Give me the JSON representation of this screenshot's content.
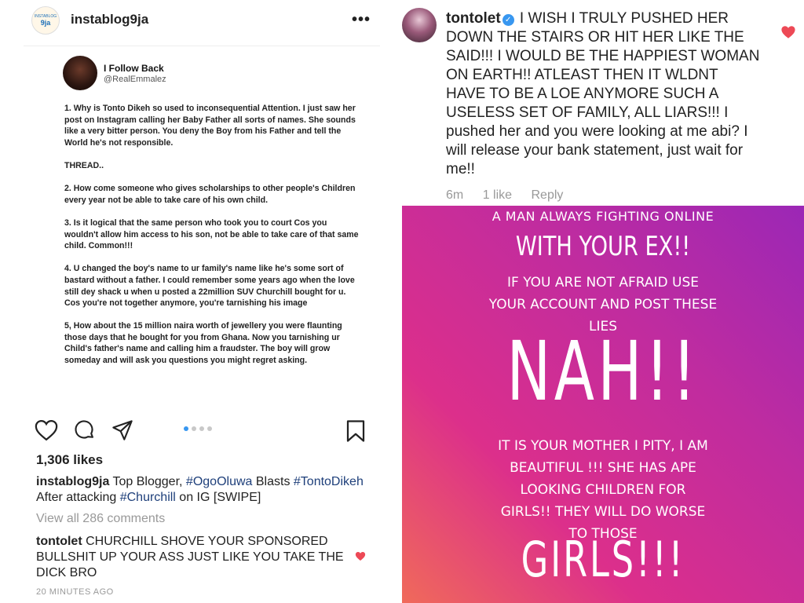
{
  "left_post": {
    "logo_text_top": "INSTABLOG",
    "logo_text_bottom": "9ja",
    "username": "instablog9ja",
    "more": "•••",
    "tweet": {
      "name": "I Follow Back",
      "handle": "@RealEmmalez",
      "paragraphs": [
        "1. Why is Tonto Dikeh so used to inconsequential Attention. I just saw her post on Instagram calling her Baby Father all sorts of names. She sounds like a very bitter person. You deny the Boy from his Father and tell the World he's not responsible.",
        "THREAD..",
        "2. How come someone who gives scholarships to other people's Children every year not be able to take care of his own child.",
        "3. Is it logical that the same person who took you to court Cos you wouldn't allow him access to his son, not be able to take care of that same child. Common!!!",
        "4. U changed the boy's name to ur family's name like he's some sort of bastard without a father. I could remember some years ago when the love still dey shack u when u posted a 22million SUV Churchill bought for u. Cos you're not together anymore, you're tarnishing his image",
        "5, How about the 15 million naira worth of jewellery you were flaunting those days that he bought for you from Ghana. Now you tarnishing ur Child's father's name and calling him a fraudster. The boy will grow someday and will ask you questions you might regret asking."
      ]
    },
    "likes": "1,306 likes",
    "caption": {
      "username": "instablog9ja",
      "text_1": " Top Blogger, ",
      "tag_1": "#OgoOluwa",
      "text_2": " Blasts ",
      "tag_2": "#TontoDikeh",
      "text_3": " After attacking ",
      "tag_3": "#Churchill",
      "text_4": " on IG [SWIPE]"
    },
    "view_all": "View all 286 comments",
    "comment": {
      "username": "tontolet",
      "text": " CHURCHILL SHOVE YOUR SPONSORED BULLSHIT UP YOUR ASS JUST LIKE YOU TAKE THE DICK BRO"
    },
    "time_ago": "20 MINUTES AGO"
  },
  "right_post": {
    "comment": {
      "username": "tontolet",
      "verified_mark": "✓",
      "text": " I WISH I TRULY PUSHED HER DOWN THE STAIRS OR HIT HER LIKE THE SAID!!! I WOULD BE THE HAPPIEST WOMAN ON EARTH!! ATLEAST THEN IT WLDNT HAVE TO BE A LOE ANYMORE SUCH A USELESS SET OF FAMILY, ALL LIARS!!! I pushed her and you were looking at me abi? I will release your bank statement, just wait for me!!"
    },
    "meta": {
      "time": "6m",
      "likes": "1 like",
      "reply": "Reply"
    },
    "story": {
      "line1": "A MAN ALWAYS FIGHTING ONLINE",
      "line2": "WITH YOUR EX!!",
      "line3": "IF YOU ARE NOT AFRAID USE YOUR ACCOUNT AND POST THESE LIES",
      "line4": "NAH!!",
      "line5": "IT IS YOUR MOTHER I PITY, I AM BEAUTIFUL !!! SHE HAS APE LOOKING CHILDREN FOR GIRLS!! THEY WILL DO WORSE TO THOSE",
      "line6": "GIRLS!!!"
    }
  },
  "carousel": {
    "count": 4,
    "active": 1
  },
  "colors": {
    "heart_red": "#ed4956",
    "link_blue": "#1e3f7a",
    "dot_active": "#3897f0",
    "story_gradient": [
      "#9b27b6",
      "#dc2f8b",
      "#f06a5a"
    ]
  },
  "icons": [
    "heart-icon",
    "comment-icon",
    "share-icon",
    "bookmark-icon",
    "more-icon",
    "verified-icon"
  ]
}
